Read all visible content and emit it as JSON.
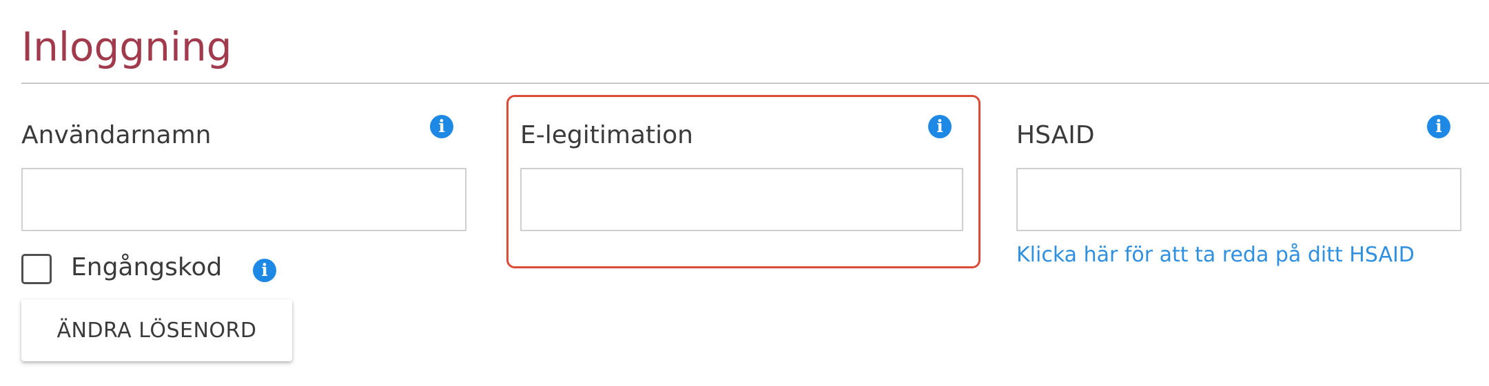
{
  "section": {
    "title": "Inloggning"
  },
  "fields": {
    "username": {
      "label": "Användarnamn",
      "value": "",
      "info_icon": "info-circle-icon"
    },
    "eid": {
      "label": "E-legitimation",
      "value": "",
      "info_icon": "info-circle-icon",
      "highlighted": true
    },
    "hsaid": {
      "label": "HSAID",
      "value": "",
      "info_icon": "info-circle-icon",
      "help_link": "Klicka här för att ta reda på ditt HSAID"
    }
  },
  "one_time_code": {
    "label": "Engångskod",
    "checked": false,
    "info_icon": "info-circle-icon"
  },
  "buttons": {
    "change_password": "ÄNDRA LÖSENORD"
  },
  "colors": {
    "title": "#a03a4c",
    "info_icon": "#1e88e5",
    "highlight_border": "#dc4a38",
    "link": "#2f8fe0"
  }
}
